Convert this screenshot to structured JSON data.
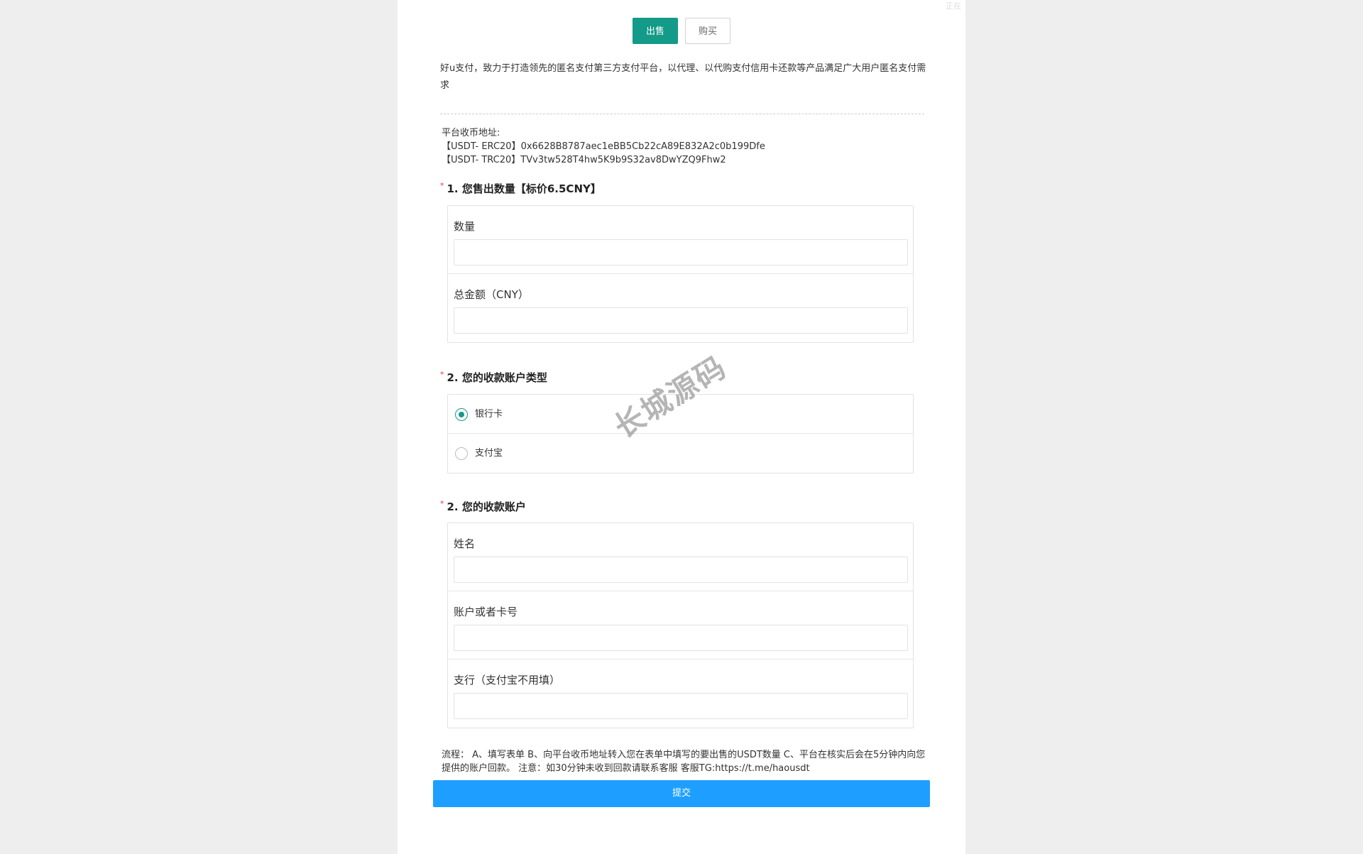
{
  "corner_text": "正在",
  "tabs": [
    {
      "label": "出售",
      "active": true
    },
    {
      "label": "购买",
      "active": false
    }
  ],
  "intro": "好u支付，致力于打造领先的匿名支付第三方支付平台，以代理、以代购支付信用卡还款等产品满足广大用户匿名支付需求",
  "addresses": {
    "title": "平台收币地址:",
    "erc20": "【USDT- ERC20】0x6628B8787aec1eBB5Cb22cA89E832A2c0b199Dfe",
    "trc20": "【USDT- TRC20】TVv3tw528T4hw5K9b9S32av8DwYZQ9Fhw2"
  },
  "section1": {
    "required_mark": "*",
    "title": "1. 您售出数量【标价6.5CNY】",
    "fields": [
      {
        "label": "数量",
        "value": ""
      },
      {
        "label": "总金额（CNY）",
        "value": ""
      }
    ]
  },
  "section2": {
    "required_mark": "*",
    "title": "2. 您的收款账户类型",
    "options": [
      {
        "label": "银行卡",
        "checked": true
      },
      {
        "label": "支付宝",
        "checked": false
      }
    ]
  },
  "section3": {
    "required_mark": "*",
    "title": "2. 您的收款账户",
    "fields": [
      {
        "label": "姓名",
        "value": ""
      },
      {
        "label": "账户或者卡号",
        "value": ""
      },
      {
        "label": "支行（支付宝不用填）",
        "value": ""
      }
    ]
  },
  "watermark": "长城源码",
  "process": "流程： A、填写表单 B、向平台收币地址转入您在表单中填写的要出售的USDT数量 C、平台在核实后会在5分钟内向您提供的账户回款。 注意：如30分钟未收到回款请联系客服 客服TG:https://t.me/haousdt",
  "submit_label": "提交",
  "colors": {
    "accent": "#139a88",
    "submit": "#1e9fff",
    "required": "#e3393c"
  }
}
